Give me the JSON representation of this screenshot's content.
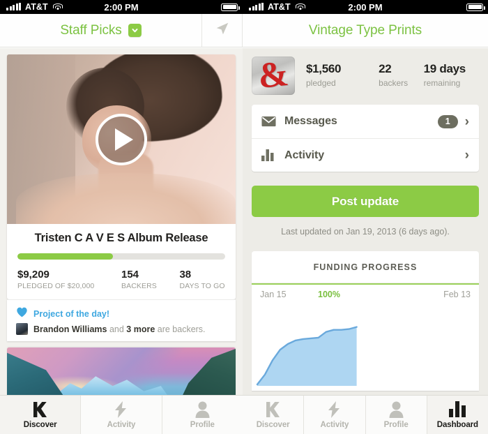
{
  "status_bar": {
    "carrier": "AT&T",
    "time": "2:00 PM",
    "signal_icon": "signal-bars-icon",
    "wifi_icon": "wifi-icon",
    "battery_icon": "battery-icon"
  },
  "left_app": {
    "nav": {
      "title": "Staff Picks",
      "dropdown_icon": "chevron-down-icon",
      "badge_color": "#8ccb45"
    },
    "featured_project": {
      "media_icon": "play-icon",
      "title": "Tristen C A V E S Album Release",
      "progress_percent": 46,
      "progress_color": "#8ccb45",
      "stats": [
        {
          "value": "$9,209",
          "label": "PLEDGED OF $20,000"
        },
        {
          "value": "154",
          "label": "BACKERS"
        },
        {
          "value": "38",
          "label": "DAYS TO GO"
        }
      ],
      "promo": {
        "heart_icon": "heart-icon",
        "text": "Project of the day!",
        "color": "#3fa8e0"
      },
      "backers_line": {
        "avatar_icon": "avatar-icon",
        "name": "Brandon Williams",
        "connector": " and ",
        "more": "3 more",
        "suffix": " are backers."
      }
    },
    "tabs": [
      {
        "label": "Discover",
        "icon": "kickstarter-k-icon",
        "active": true
      },
      {
        "label": "Activity",
        "icon": "lightning-bolt-icon",
        "active": false
      },
      {
        "label": "Profile",
        "icon": "person-icon",
        "active": false
      }
    ]
  },
  "divider": {
    "icon": "navigation-arrow-icon"
  },
  "right_app": {
    "nav": {
      "title": "Vintage Type Prints"
    },
    "project": {
      "thumbnail_icon": "ampersand-print-thumbnail",
      "thumbnail_glyph": "&",
      "stats": [
        {
          "value": "$1,560",
          "label": "pledged"
        },
        {
          "value": "22",
          "label": "backers"
        },
        {
          "value": "19 days",
          "label": "remaining"
        }
      ]
    },
    "menu": [
      {
        "label": "Messages",
        "icon": "envelope-icon",
        "badge": "1",
        "chevron": "›"
      },
      {
        "label": "Activity",
        "icon": "bar-chart-icon",
        "badge": null,
        "chevron": "›"
      }
    ],
    "post_update_button": "Post update",
    "last_updated": "Last updated on Jan 19, 2013 (6 days ago).",
    "tabs": [
      {
        "label": "Discover",
        "icon": "kickstarter-k-icon",
        "active": false
      },
      {
        "label": "Activity",
        "icon": "lightning-bolt-icon",
        "active": false
      },
      {
        "label": "Profile",
        "icon": "person-icon",
        "active": false
      },
      {
        "label": "Dashboard",
        "icon": "bar-chart-icon",
        "active": true
      }
    ]
  },
  "chart_data": {
    "type": "area",
    "title": "FUNDING PROGRESS",
    "xlabel": "",
    "ylabel": "",
    "x_start_label": "Jan 15",
    "x_end_label": "Feb 13",
    "goal_label": "100%",
    "goal_value": 100,
    "grid": false,
    "legend": "none",
    "line_color": "#6aa9dc",
    "fill_color": "#aed6f2",
    "goal_color": "#9ad05a",
    "ylim": [
      0,
      115
    ],
    "xlim": [
      0,
      29
    ],
    "x": [
      0,
      1,
      2,
      3,
      4,
      5,
      6,
      7,
      8,
      9,
      10,
      11,
      12,
      13
    ],
    "y": [
      0,
      14,
      34,
      49,
      57,
      62,
      64,
      65,
      66,
      74,
      77,
      77,
      78,
      81
    ],
    "x_tick_labels": [
      "Jan 15",
      "Feb 13"
    ],
    "annotations": [
      {
        "text": "100%",
        "x": 8.5,
        "y": 100
      }
    ]
  }
}
